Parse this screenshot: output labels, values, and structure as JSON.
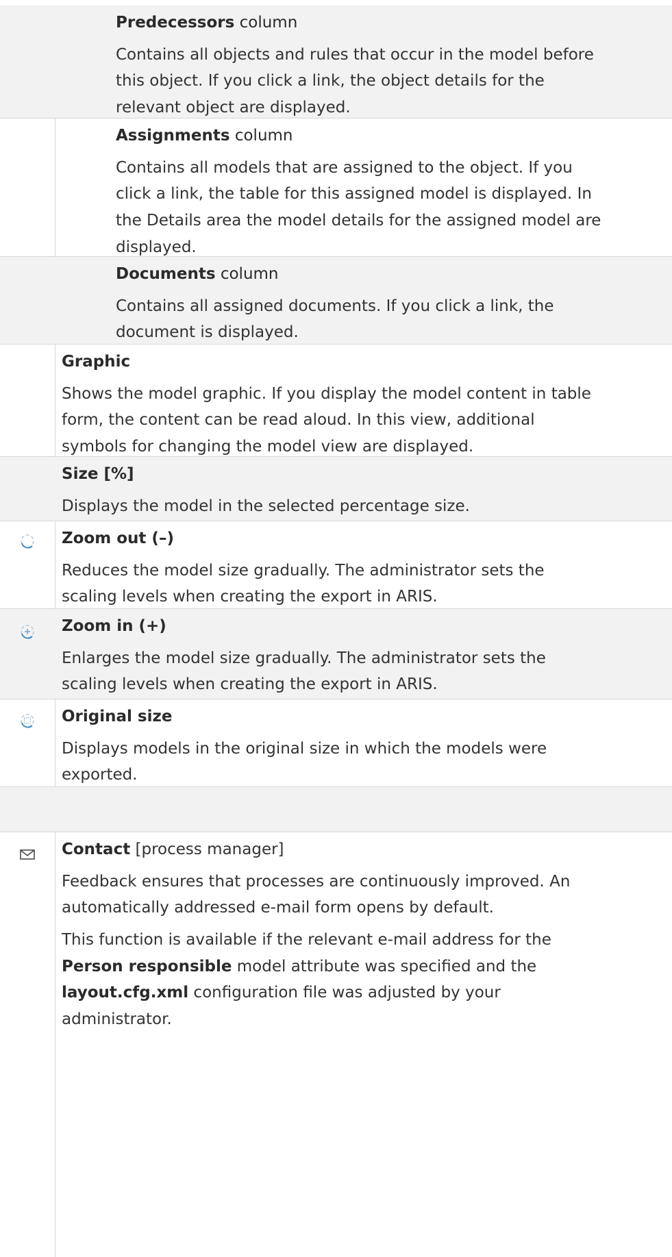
{
  "sections": {
    "predecessors": {
      "title": "Predecessors",
      "suffix": " column",
      "lines": [
        "Contains all objects and rules that occur in the model before",
        "this object. If you click a link, the object details for the",
        "relevant object are displayed."
      ]
    },
    "assignments": {
      "title": "Assignments",
      "suffix": " column",
      "lines": [
        "Contains all models that are assigned to the object. If you",
        "click a link, the table for this assigned model is displayed. In",
        "the Details area the model details for the assigned model are",
        "displayed."
      ]
    },
    "documents": {
      "title": "Documents",
      "suffix": " column",
      "lines": [
        "Contains all assigned documents. If you click a link, the",
        "document is displayed."
      ]
    },
    "graphic": {
      "title": "Graphic",
      "lines": [
        "Shows the model graphic. If you display the model content in table",
        "form, the content can be read aloud. In this view, additional",
        "symbols for changing the model view are displayed."
      ]
    },
    "size": {
      "title": "Size [%]",
      "lines": [
        "Displays the model in the selected percentage size."
      ]
    },
    "zoom_out": {
      "title": "Zoom out (–)",
      "icon": "zoom-out-icon",
      "lines": [
        "Reduces the model size gradually. The administrator sets the",
        "scaling levels when creating the export in ARIS."
      ]
    },
    "zoom_in": {
      "title": "Zoom in (+)",
      "icon": "zoom-in-icon",
      "lines": [
        "Enlarges the model size gradually. The administrator sets the",
        "scaling levels when creating the export in ARIS."
      ]
    },
    "original_size": {
      "title": "Original size",
      "icon": "original-size-icon",
      "lines": [
        "Displays models in the original size in which the models were",
        "exported."
      ]
    },
    "contact": {
      "title": "Contact",
      "suffix": " [process manager]",
      "icon": "envelope-icon",
      "lines": [
        "Feedback ensures that processes are continuously improved. An",
        "automatically addressed e-mail form opens by default."
      ],
      "p2_line1": "This function is available if the relevant e-mail address for the",
      "p2_bold1": "Person responsible",
      "p2_after1": " model attribute was specified and the",
      "p2_bold2": "layout.cfg.xml",
      "p2_after2": " configuration file was adjusted by your",
      "p2_line4": "administrator."
    }
  }
}
